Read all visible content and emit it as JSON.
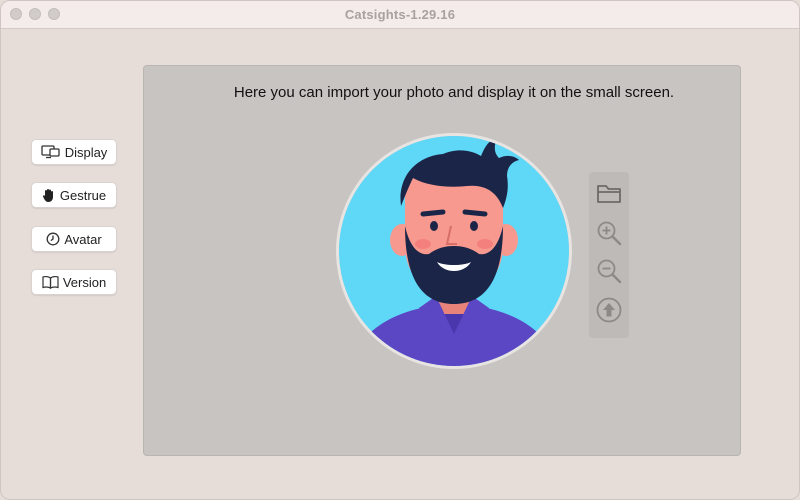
{
  "window": {
    "title": "Catsights-1.29.16"
  },
  "sidebar": {
    "items": [
      {
        "label": "Display",
        "icon": "display-icon"
      },
      {
        "label": "Gestrue",
        "icon": "hand-icon"
      },
      {
        "label": "Avatar",
        "icon": "clock-icon"
      },
      {
        "label": "Version",
        "icon": "book-icon"
      }
    ]
  },
  "main": {
    "instruction": "Here you can import your photo and display it on the small screen.",
    "tools": [
      "folder-icon",
      "zoom-in-icon",
      "zoom-out-icon",
      "upload-icon"
    ]
  },
  "colors": {
    "avatar_background": "#5fd8f8",
    "shirt": "#5b46c4",
    "hair": "#1b2548",
    "skin": "#f7998e"
  }
}
